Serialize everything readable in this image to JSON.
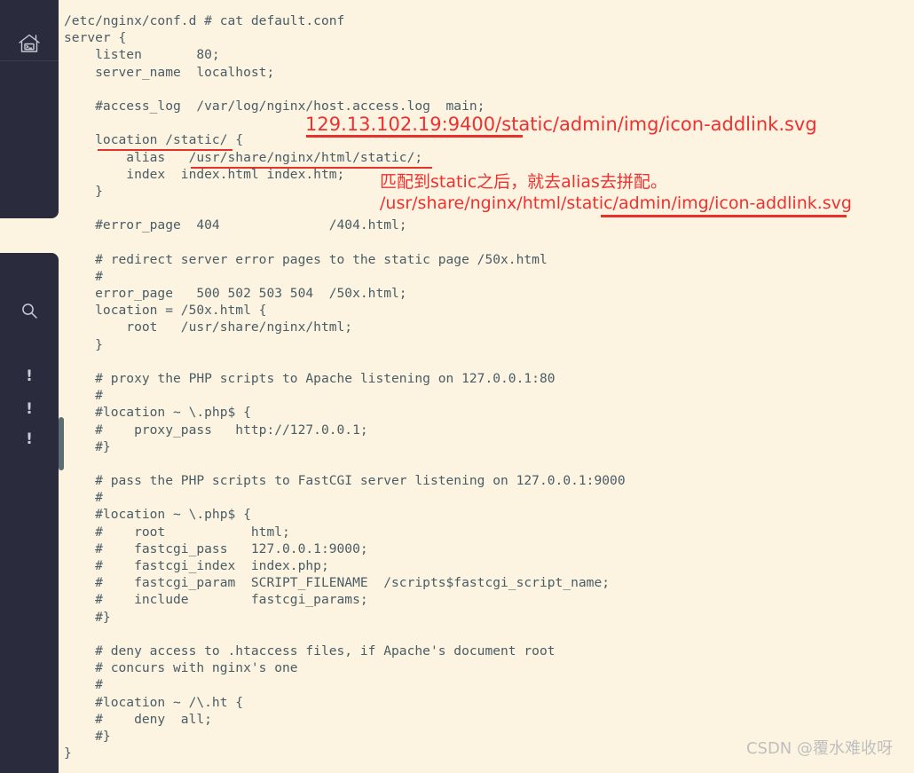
{
  "window": {
    "background_color": "#fcf4e0",
    "sidebar_color": "#2a2b3d",
    "code_text_color": "#4a5c66",
    "annotation_color": "#f03030"
  },
  "sidebar": {
    "items": [
      {
        "name": "home-terminal-icon",
        "icon": "home-terminal-icon",
        "label": ""
      },
      {
        "name": "search-icon",
        "icon": "search-icon",
        "label": ""
      },
      {
        "name": "alert-icon-1",
        "icon": "exclamation-icon",
        "label": "!"
      },
      {
        "name": "alert-icon-2",
        "icon": "exclamation-icon",
        "label": "!"
      },
      {
        "name": "alert-icon-3",
        "icon": "exclamation-icon",
        "label": "!"
      }
    ]
  },
  "terminal": {
    "prompt_line": "/etc/nginx/conf.d # cat default.conf",
    "lines": [
      "/etc/nginx/conf.d # cat default.conf",
      "server {",
      "    listen       80;",
      "    server_name  localhost;",
      "",
      "    #access_log  /var/log/nginx/host.access.log  main;",
      "",
      "    location /static/ {",
      "        alias   /usr/share/nginx/html/static/;",
      "        index  index.html index.htm;",
      "    }",
      "",
      "    #error_page  404              /404.html;",
      "",
      "    # redirect server error pages to the static page /50x.html",
      "    #",
      "    error_page   500 502 503 504  /50x.html;",
      "    location = /50x.html {",
      "        root   /usr/share/nginx/html;",
      "    }",
      "",
      "    # proxy the PHP scripts to Apache listening on 127.0.0.1:80",
      "    #",
      "    #location ~ \\.php$ {",
      "    #    proxy_pass   http://127.0.0.1;",
      "    #}",
      "",
      "    # pass the PHP scripts to FastCGI server listening on 127.0.0.1:9000",
      "    #",
      "    #location ~ \\.php$ {",
      "    #    root           html;",
      "    #    fastcgi_pass   127.0.0.1:9000;",
      "    #    fastcgi_index  index.php;",
      "    #    fastcgi_param  SCRIPT_FILENAME  /scripts$fastcgi_script_name;",
      "    #    include        fastcgi_params;",
      "    #}",
      "",
      "    # deny access to .htaccess files, if Apache's document root",
      "    # concurs with nginx's one",
      "    #",
      "    #location ~ /\\.ht {",
      "    #    deny  all;",
      "    #}",
      "}"
    ]
  },
  "annotations": {
    "request_url": "129.13.102.19:9400/static/admin/img/icon-addlink.svg",
    "chinese_note": "匹配到static之后，就去alias去拼配。",
    "resolved_path": "/usr/share/nginx/html/static/admin/img/icon-addlink.svg"
  },
  "watermark": {
    "text": "CSDN @覆水难收呀"
  }
}
